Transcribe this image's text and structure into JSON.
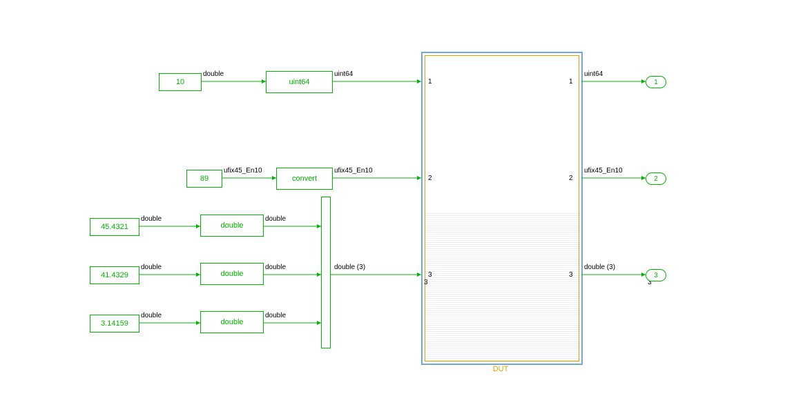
{
  "colors": {
    "signal": "#00b400",
    "dut_border": "#70a8d8",
    "dut_accent": "#d9a300"
  },
  "constants": {
    "c1": "10",
    "c2": "89",
    "c3": "45.4321",
    "c4": "41.4329",
    "c5": "3.14159"
  },
  "converters": {
    "cv1": "uint64",
    "cv2": "convert",
    "cv3": "double",
    "cv4": "double",
    "cv5": "double"
  },
  "signals": {
    "s1_pre": "double",
    "s1_post": "uint64",
    "s2_pre": "ufix45_En10",
    "s2_post": "ufix45_En10",
    "s3_pre": "double",
    "s3_post": "double",
    "s4_pre": "double",
    "s4_post": "double",
    "s5_pre": "double",
    "s5_post": "double",
    "mux_out": "double (3)",
    "mux_num": "3",
    "out1": "uint64",
    "out2": "ufix45_En10",
    "out3": "double (3)",
    "out3_num": "3"
  },
  "dut": {
    "label": "DUT",
    "inports": {
      "p1": "1",
      "p2": "2",
      "p3": "3"
    },
    "outports": {
      "p1": "1",
      "p2": "2",
      "p3": "3"
    }
  },
  "outport_blocks": {
    "o1": "1",
    "o2": "2",
    "o3": "3"
  }
}
